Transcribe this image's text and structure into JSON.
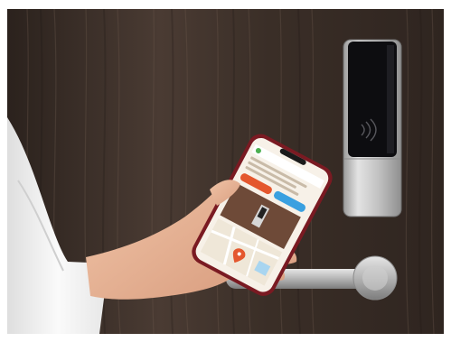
{
  "scene": {
    "kind": "photo",
    "colors": {
      "door_wood": "#3a2e27",
      "door_wood_light": "#5a4a40",
      "lock_body": "#c8c8c8",
      "lock_panel": "#0d0d10",
      "handle": "#bdbdbd",
      "phone_frame": "#7a1a22",
      "phone_screen_bg": "#f7f1e8",
      "app_orange": "#e4572e",
      "app_blue": "#3aa0e0",
      "sleeve": "#f2f2f2",
      "skin": "#e9b79a"
    }
  },
  "phone": {
    "app": {
      "buttons": [
        {
          "color_key": "app_orange"
        },
        {
          "color_key": "app_blue"
        }
      ],
      "map_pin_color": "#e4572e"
    }
  }
}
